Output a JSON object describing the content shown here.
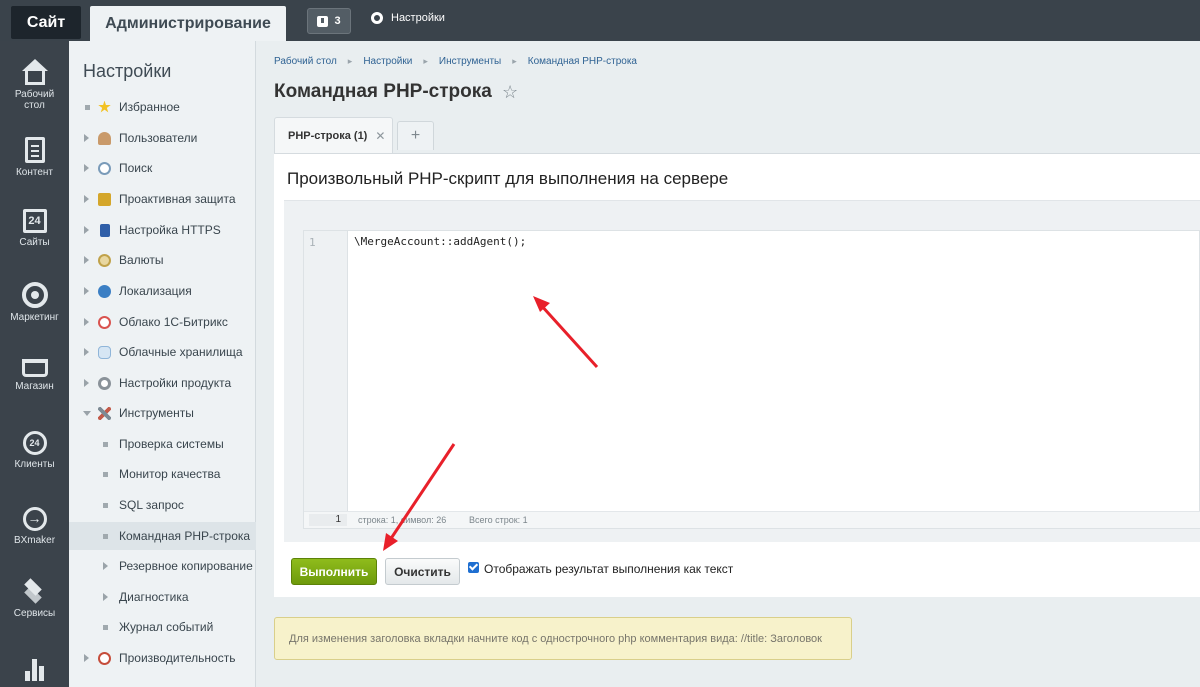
{
  "topbar": {
    "site_label": "Сайт",
    "admin_label": "Администрирование",
    "notifications_count": "3",
    "settings_label": "Настройки"
  },
  "leftbar": [
    {
      "label": "Рабочий стол",
      "icon": "home-icon"
    },
    {
      "label": "Контент",
      "icon": "document-icon"
    },
    {
      "label": "Сайты",
      "icon": "calendar-24-icon"
    },
    {
      "label": "Маркетинг",
      "icon": "target-icon"
    },
    {
      "label": "Магазин",
      "icon": "basket-icon"
    },
    {
      "label": "Клиенты",
      "icon": "clients-24-icon"
    },
    {
      "label": "BXmaker",
      "icon": "arrow-circle-icon"
    },
    {
      "label": "Сервисы",
      "icon": "layers-icon"
    },
    {
      "label": "",
      "icon": "bar-chart-icon"
    }
  ],
  "sidebar": {
    "title": "Настройки",
    "items": [
      {
        "label": "Избранное",
        "icon": "star-icon",
        "color": "#f2c224"
      },
      {
        "label": "Пользователи",
        "icon": "user-icon",
        "color": "#c99a6a"
      },
      {
        "label": "Поиск",
        "icon": "magnifier-icon",
        "color": "#7a9bb9"
      },
      {
        "label": "Проактивная защита",
        "icon": "lock-icon",
        "color": "#d4a62a"
      },
      {
        "label": "Настройка HTTPS",
        "icon": "https-lock-icon",
        "color": "#2f5fa8"
      },
      {
        "label": "Валюты",
        "icon": "currency-icon",
        "color": "#c0a24a"
      },
      {
        "label": "Локализация",
        "icon": "globe-icon",
        "color": "#3b7fc4"
      },
      {
        "label": "Облако 1С-Битрикс",
        "icon": "cloud-bitrix-icon",
        "color": "#d9534f"
      },
      {
        "label": "Облачные хранилища",
        "icon": "cloud-storage-icon",
        "color": "#8fb5d9"
      },
      {
        "label": "Настройки продукта",
        "icon": "product-gear-icon",
        "color": "#8a9299"
      },
      {
        "label": "Инструменты",
        "icon": "tools-icon",
        "color": "#7d8a94"
      }
    ],
    "subitems": [
      {
        "label": "Проверка системы"
      },
      {
        "label": "Монитор качества"
      },
      {
        "label": "SQL запрос"
      },
      {
        "label": "Командная PHP-строка"
      },
      {
        "label": "Резервное копирование"
      },
      {
        "label": "Диагностика"
      },
      {
        "label": "Журнал событий"
      }
    ],
    "last_item": {
      "label": "Производительность",
      "icon": "speedometer-icon",
      "color": "#c64d3b"
    }
  },
  "breadcrumb": [
    "Рабочий стол",
    "Настройки",
    "Инструменты",
    "Командная PHP-строка"
  ],
  "page": {
    "title": "Командная PHP-строка",
    "tab_label": "PHP-строка (1)",
    "tab_add": "+",
    "panel_title": "Произвольный PHP-скрипт для выполнения на сервере"
  },
  "editor": {
    "line_number": "1",
    "code": "\\MergeAccount::addAgent();",
    "status_current_line": "1",
    "status_info": "строка: 1, символ: 26",
    "status_total": "Всего строк: 1"
  },
  "actions": {
    "run_label": "Выполнить",
    "clear_label": "Очистить",
    "checkbox_label": "Отображать результат выполнения как текст",
    "checkbox_checked": true
  },
  "notice": "Для изменения заголовка вкладки начните код с однострочного php комментария вида: //title: Заголовок",
  "colors": {
    "run_button": "#7aa813",
    "annotation_arrow": "#e8202a",
    "link": "#2f6293"
  }
}
